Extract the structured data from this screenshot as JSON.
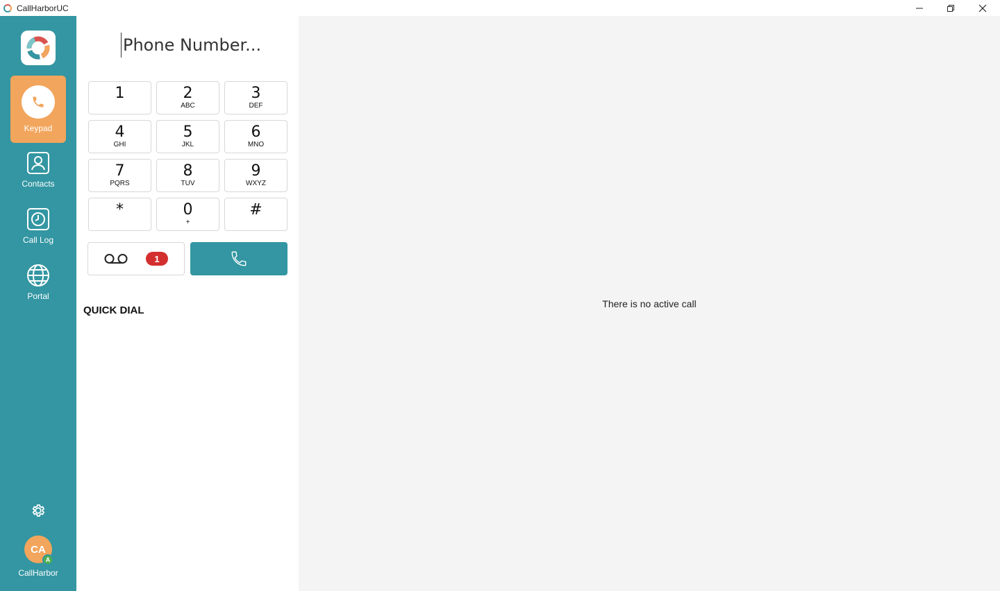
{
  "window": {
    "title": "CallHarborUC"
  },
  "sidebar": {
    "items": [
      {
        "label": "Keypad",
        "icon": "phone-icon",
        "active": true
      },
      {
        "label": "Contacts",
        "icon": "contact-card-icon"
      },
      {
        "label": "Call Log",
        "icon": "clock-icon"
      },
      {
        "label": "Portal",
        "icon": "globe-icon"
      }
    ],
    "user": {
      "initials": "CA",
      "status_letter": "A",
      "name": "CallHarbor"
    }
  },
  "dialpad": {
    "placeholder": "Phone Number...",
    "keys": [
      {
        "digit": "1",
        "letters": ""
      },
      {
        "digit": "2",
        "letters": "ABC"
      },
      {
        "digit": "3",
        "letters": "DEF"
      },
      {
        "digit": "4",
        "letters": "GHI"
      },
      {
        "digit": "5",
        "letters": "JKL"
      },
      {
        "digit": "6",
        "letters": "MNO"
      },
      {
        "digit": "7",
        "letters": "PQRS"
      },
      {
        "digit": "8",
        "letters": "TUV"
      },
      {
        "digit": "9",
        "letters": "WXYZ"
      },
      {
        "digit": "*",
        "letters": ""
      },
      {
        "digit": "0",
        "letters": "+"
      },
      {
        "digit": "#",
        "letters": ""
      }
    ],
    "voicemail_count": "1",
    "quick_dial_label": "QUICK DIAL"
  },
  "main": {
    "status": "There is no active call"
  },
  "colors": {
    "accent": "#3396a2",
    "active_nav": "#f2a55c",
    "badge": "#d32f2f"
  }
}
